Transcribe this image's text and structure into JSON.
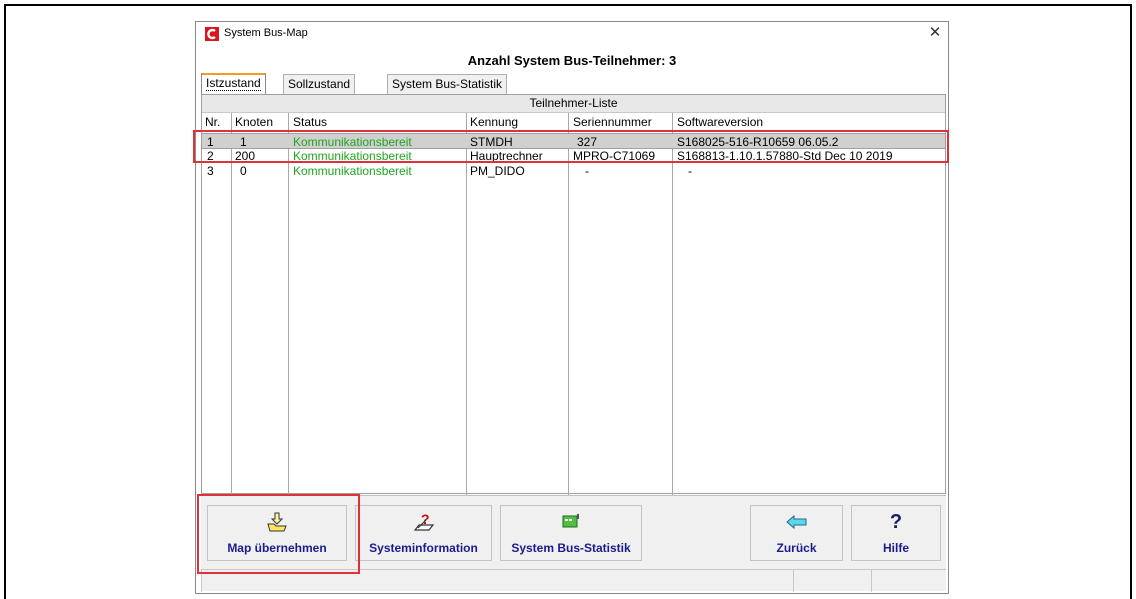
{
  "window": {
    "title": "System Bus-Map",
    "close_glyph": "✕",
    "heading": "Anzahl System Bus-Teilnehmer: 3"
  },
  "tabs": [
    {
      "label": "Istzustand",
      "active": true
    },
    {
      "label": "Sollzustand",
      "active": false
    },
    {
      "label": "System Bus-Statistik",
      "active": false
    }
  ],
  "table": {
    "title": "Teilnehmer-Liste",
    "columns": [
      "Nr.",
      "Knoten",
      "Status",
      "Kennung",
      "Seriennummer",
      "Softwareversion"
    ],
    "rows": [
      {
        "nr": "1",
        "knoten": "1",
        "status": "Kommunikationsbereit",
        "kennung": "STMDH",
        "serien": "327",
        "software": "S168025-516-R10659 06.05.2",
        "selected": true
      },
      {
        "nr": "2",
        "knoten": "200",
        "status": "Kommunikationsbereit",
        "kennung": "Hauptrechner",
        "serien": "MPRO-C71069",
        "software": "S168813-1.10.1.57880-Std Dec 10 2019",
        "selected": false
      },
      {
        "nr": "3",
        "knoten": "0",
        "status": "Kommunikationsbereit",
        "kennung": "PM_DIDO",
        "serien": "-",
        "software": "-",
        "selected": false
      }
    ]
  },
  "toolbar": {
    "map": {
      "label": "Map übernehmen",
      "icon": "folder-arrow-down-icon"
    },
    "sysinfo": {
      "label": "Systeminformation",
      "icon": "question-pen-icon"
    },
    "stats": {
      "label": "System Bus-Statistik",
      "icon": "circuit-board-icon"
    },
    "back": {
      "label": "Zurück",
      "icon": "arrow-left-icon"
    },
    "help": {
      "label": "Hilfe",
      "icon": "help-question-icon",
      "glyph": "?"
    }
  },
  "colors": {
    "status_ok": "#1fa51f",
    "button_text": "#1b1b8c",
    "highlight": "#e0303a",
    "tab_accent": "#f39a2c"
  }
}
